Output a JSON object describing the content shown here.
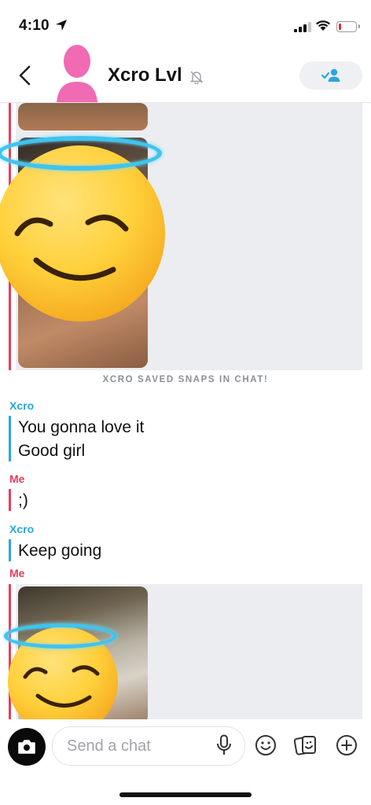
{
  "status_bar": {
    "time": "4:10"
  },
  "header": {
    "contact_name": "Xcro Lvl"
  },
  "chat": {
    "saved_notice": "XCRO SAVED SNAPS IN CHAT!",
    "messages": [
      {
        "sender": "Xcro",
        "lines": [
          "You gonna love it",
          "Good girl"
        ]
      },
      {
        "sender": "Me",
        "lines": [
          ";)"
        ]
      },
      {
        "sender": "Xcro",
        "lines": [
          "Keep going"
        ]
      },
      {
        "sender": "Me",
        "lines": []
      }
    ]
  },
  "composer": {
    "placeholder": "Send a chat"
  },
  "icons": {
    "status": [
      "location-arrow-icon",
      "signal-icon",
      "wifi-icon",
      "battery-icon"
    ],
    "header": [
      "back-chevron-icon",
      "avatar-icon",
      "mute-bell-icon",
      "add-friend-icon"
    ],
    "composer": [
      "camera-icon",
      "microphone-icon",
      "smiley-icon",
      "sticker-icon",
      "plus-icon"
    ]
  },
  "colors": {
    "xcro": "#2aa6e0",
    "me": "#e83d5c",
    "avatar": "#f06ab4",
    "halo": "#3fc4ef"
  }
}
